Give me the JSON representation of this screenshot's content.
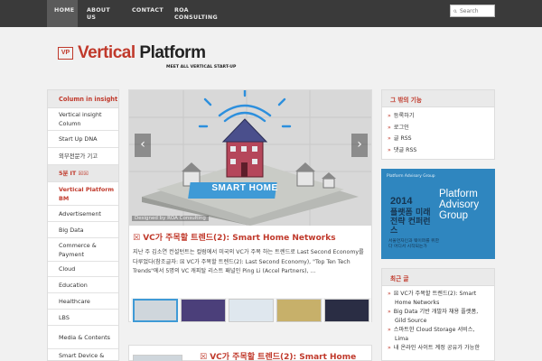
{
  "nav": {
    "items": [
      "HOME",
      "ABOUT\nUS",
      "CONTACT",
      "ROA\nCONSULTING"
    ],
    "search_placeholder": "Search"
  },
  "logo": {
    "badge": "VP",
    "word1": "Vertical",
    "word2": "Platform",
    "tagline": "MEET ALL VERTICAL START-UP"
  },
  "left_sidebar": {
    "header": "Column in insight",
    "items": [
      {
        "label": "Vertical insight Column",
        "style": "normal"
      },
      {
        "label": "Start Up DNA",
        "style": "normal"
      },
      {
        "label": "외부전문가 기고",
        "style": "normal"
      },
      {
        "label": "5분 IT ☒☒",
        "style": "section"
      },
      {
        "label": "Vertical Platform BM",
        "style": "red"
      },
      {
        "label": "Advertisement",
        "style": "normal"
      },
      {
        "label": "Big Data",
        "style": "normal"
      },
      {
        "label": "Commerce & Payment",
        "style": "normal"
      },
      {
        "label": "Cloud",
        "style": "normal"
      },
      {
        "label": "Education",
        "style": "normal"
      },
      {
        "label": "Healthcare",
        "style": "normal"
      },
      {
        "label": "LBS",
        "style": "normal"
      },
      {
        "label": "Media & Contents",
        "style": "normal"
      },
      {
        "label": "Smart Device &",
        "style": "normal"
      }
    ]
  },
  "slider": {
    "banner": "SMART HOME",
    "caption": "Designed by ROA Consulting",
    "prev_icon": "chevron-left-icon",
    "next_icon": "chevron-right-icon"
  },
  "post": {
    "title": "☒ VC가 주목할 트렌드(2): Smart Home Networks",
    "excerpt": "지난 주 김소연 컨설턴트는 컬럼에서 미국의 VC가 주목 하는 트렌드로 Last Second Economy를 다루었다(참조글자: ☒ VC가 주목할 트렌드(2): Last Second Economy), \"Top Ten Tech Trends\"에서 5명의 VC 캐피탈 리스트 패널인 Ping Li (Accel Partners), ..."
  },
  "post2": {
    "title": "☒ VC가 주목할 트렌드(2): Smart Home"
  },
  "right_sidebar": {
    "features_header": "그 밖의 기능",
    "features": [
      "등록하기",
      "로그인",
      "글 RSS",
      "댓글 RSS"
    ],
    "recent_header": "최근 글",
    "recent": [
      "☒ VC가 주목할 트렌드(2): Smart Home Networks",
      "Big Data 기반 개발자 채용 플랫폼, Gild Source",
      "스마트한 Cloud Storage 서비스, Lima",
      "내 온라인 사이트 계정 공유가 가능한"
    ]
  },
  "ad": {
    "brand": "Platform Advisory Group",
    "year": "2014",
    "ko_title": "플랫폼 미래전략 컨퍼런스",
    "en_title": "Platform Advisory Group",
    "ko_sub": "서울먼자인과 웨이퍼를 위한다 어디서 시작되는가"
  },
  "colors": {
    "accent": "#c0392b",
    "topbar": "#3a3a3a",
    "ad_bg": "#2f86bf"
  }
}
